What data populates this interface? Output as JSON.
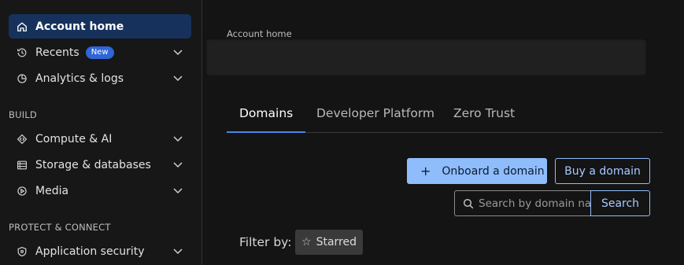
{
  "sidebar": {
    "top_items": [
      {
        "label": "Account home",
        "icon": "home-icon",
        "active": true
      },
      {
        "label": "Recents",
        "icon": "history-icon",
        "badge": "New"
      },
      {
        "label": "Analytics & logs",
        "icon": "pie-chart-icon"
      }
    ],
    "build_title": "BUILD",
    "build_items": [
      {
        "label": "Compute & AI",
        "icon": "diamond-code-icon"
      },
      {
        "label": "Storage & databases",
        "icon": "storage-icon"
      },
      {
        "label": "Media",
        "icon": "play-circle-icon"
      }
    ],
    "protect_title": "PROTECT & CONNECT",
    "protect_items": [
      {
        "label": "Application security",
        "icon": "shield-icon"
      }
    ]
  },
  "main": {
    "breadcrumb": "Account home",
    "tabs": [
      {
        "label": "Domains",
        "active": true
      },
      {
        "label": "Developer Platform"
      },
      {
        "label": "Zero Trust"
      }
    ],
    "onboard_button": "Onboard a domain",
    "buy_button": "Buy a domain",
    "search": {
      "placeholder": "Search by domain name",
      "button": "Search"
    },
    "filter_label": "Filter by:",
    "filter_chip": "Starred"
  },
  "colors": {
    "accent": "#8fbdfb",
    "active_nav": "#16325c",
    "badge": "#2f66d6",
    "tab_underline": "#4a86ea"
  }
}
